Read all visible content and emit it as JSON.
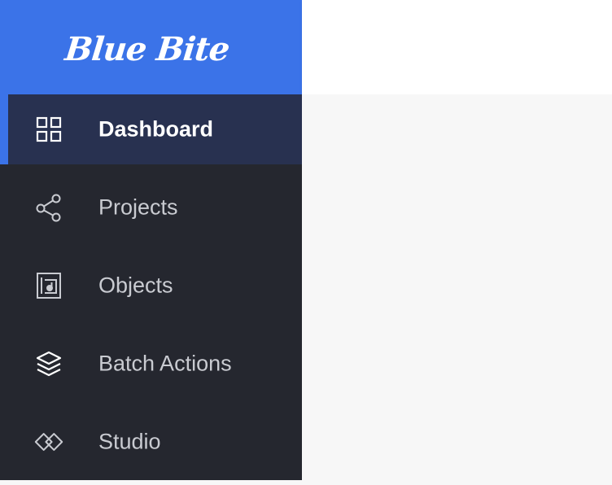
{
  "brand": {
    "logo_text": "Blue Bite"
  },
  "colors": {
    "brand_blue": "#3b73e8",
    "sidebar_bg": "#25272f",
    "active_bg": "#283150",
    "content_bg": "#f7f7f7"
  },
  "sidebar": {
    "items": [
      {
        "label": "Dashboard",
        "icon": "grid-icon",
        "active": true
      },
      {
        "label": "Projects",
        "icon": "share-icon",
        "active": false
      },
      {
        "label": "Objects",
        "icon": "object-icon",
        "active": false
      },
      {
        "label": "Batch Actions",
        "icon": "layers-icon",
        "active": false
      },
      {
        "label": "Studio",
        "icon": "diamond-link-icon",
        "active": false
      }
    ]
  }
}
